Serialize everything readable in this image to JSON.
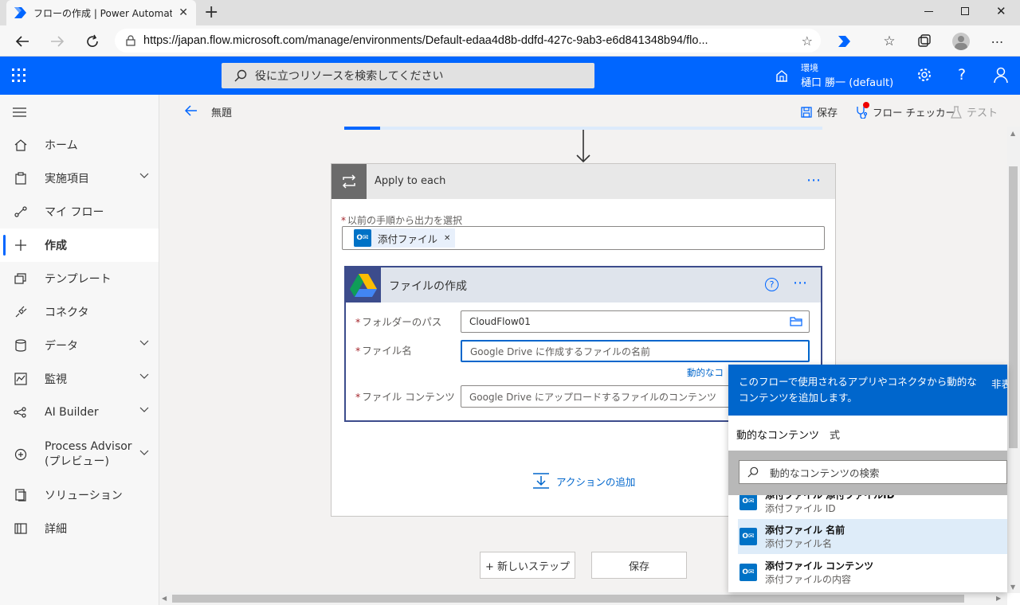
{
  "browser": {
    "tab_title": "フローの作成 | Power Automate",
    "url": "https://japan.flow.microsoft.com/manage/environments/Default-edaa4d8b-ddfd-427c-9ab3-e6d841348b94/flo..."
  },
  "app": {
    "search_placeholder": "役に立つリソースを検索してください",
    "env_label": "環境",
    "env_name": "樋口 勝一 (default)"
  },
  "sidebar": {
    "items": [
      {
        "label": "ホーム"
      },
      {
        "label": "実施項目"
      },
      {
        "label": "マイ フロー"
      },
      {
        "label": "作成"
      },
      {
        "label": "テンプレート"
      },
      {
        "label": "コネクタ"
      },
      {
        "label": "データ"
      },
      {
        "label": "監視"
      },
      {
        "label": "AI Builder"
      },
      {
        "label": "Process Advisor\n(プレビュー)"
      },
      {
        "label": "ソリューション"
      },
      {
        "label": "詳細"
      }
    ]
  },
  "cmdbar": {
    "flow_title": "無題",
    "save": "保存",
    "checker": "フロー チェッカー",
    "test": "テスト"
  },
  "apply_each": {
    "title": "Apply to each",
    "select_label": "以前の手順から出力を選択",
    "token": "添付ファイル"
  },
  "create_file": {
    "title": "ファイルの作成",
    "folder_label": "フォルダーのパス",
    "folder_value": "CloudFlow01",
    "name_label": "ファイル名",
    "name_placeholder": "Google Drive に作成するファイルの名前",
    "dynamic_link": "動的なコ",
    "content_label": "ファイル コンテンツ",
    "content_placeholder": "Google Drive にアップロードするファイルのコンテンツ"
  },
  "add_action": "アクションの追加",
  "new_step": "+ 新しいステップ",
  "save_button": "保存",
  "dynamic_panel": {
    "header": "このフローで使用されるアプリやコネクタから動的なコンテンツを追加します。",
    "header_right": "非表",
    "tab_dynamic": "動的なコンテンツ",
    "tab_expression": "式",
    "search_placeholder": "動的なコンテンツの検索",
    "items": [
      {
        "title": "添付ファイル 添付ファイルID",
        "subtitle": "添付ファイル ID"
      },
      {
        "title": "添付ファイル 名前",
        "subtitle": "添付ファイル名"
      },
      {
        "title": "添付ファイル コンテンツ",
        "subtitle": "添付ファイルの内容"
      }
    ]
  },
  "colors": {
    "brand": "#0066ff",
    "panel_header": "#0066cc",
    "required": "#a4262c"
  }
}
